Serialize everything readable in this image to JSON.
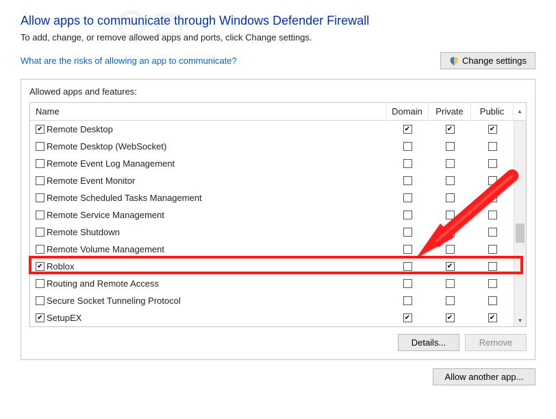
{
  "header": {
    "title": "Allow apps to communicate through Windows Defender Firewall",
    "subtitle": "To add, change, or remove allowed apps and ports, click Change settings.",
    "risks_link": "What are the risks of allowing an app to communicate?",
    "change_settings": "Change settings"
  },
  "panel": {
    "label": "Allowed apps and features:",
    "columns": {
      "name": "Name",
      "domain": "Domain",
      "private": "Private",
      "public": "Public"
    },
    "rows": [
      {
        "name": "Remote Desktop",
        "enabled": true,
        "domain": true,
        "private": true,
        "public": true
      },
      {
        "name": "Remote Desktop (WebSocket)",
        "enabled": false,
        "domain": false,
        "private": false,
        "public": false
      },
      {
        "name": "Remote Event Log Management",
        "enabled": false,
        "domain": false,
        "private": false,
        "public": false
      },
      {
        "name": "Remote Event Monitor",
        "enabled": false,
        "domain": false,
        "private": false,
        "public": false
      },
      {
        "name": "Remote Scheduled Tasks Management",
        "enabled": false,
        "domain": false,
        "private": false,
        "public": false
      },
      {
        "name": "Remote Service Management",
        "enabled": false,
        "domain": false,
        "private": false,
        "public": false
      },
      {
        "name": "Remote Shutdown",
        "enabled": false,
        "domain": false,
        "private": false,
        "public": false
      },
      {
        "name": "Remote Volume Management",
        "enabled": false,
        "domain": false,
        "private": false,
        "public": false
      },
      {
        "name": "Roblox",
        "enabled": true,
        "domain": false,
        "private": true,
        "public": false,
        "highlighted": true
      },
      {
        "name": "Routing and Remote Access",
        "enabled": false,
        "domain": false,
        "private": false,
        "public": false
      },
      {
        "name": "Secure Socket Tunneling Protocol",
        "enabled": false,
        "domain": false,
        "private": false,
        "public": false
      },
      {
        "name": "SetupEX",
        "enabled": true,
        "domain": true,
        "private": true,
        "public": true
      }
    ],
    "details": "Details...",
    "remove": "Remove"
  },
  "bottom": {
    "allow_another": "Allow another app..."
  }
}
